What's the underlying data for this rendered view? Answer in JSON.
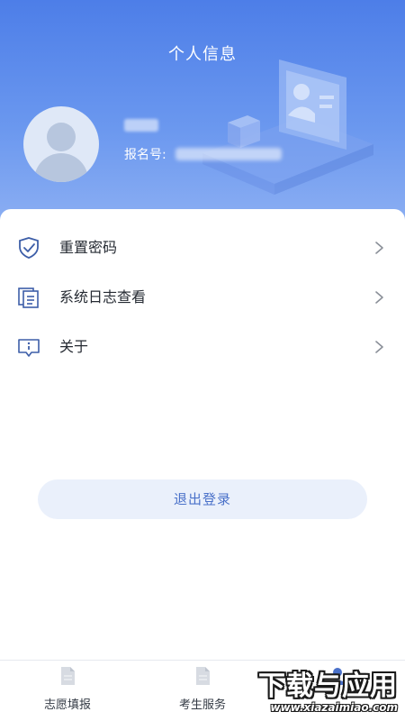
{
  "header": {
    "title": "个人信息",
    "registration_label": "报名号:",
    "avatar_icon": "user-avatar-icon"
  },
  "menu": [
    {
      "label": "重置密码",
      "icon": "shield-check-icon"
    },
    {
      "label": "系统日志查看",
      "icon": "document-list-icon"
    },
    {
      "label": "关于",
      "icon": "info-icon"
    }
  ],
  "logout_label": "退出登录",
  "tabbar": [
    {
      "label": "志愿填报",
      "icon": "document-icon"
    },
    {
      "label": "考生服务",
      "icon": "document-icon"
    },
    {
      "label": "",
      "icon": "user-icon"
    }
  ],
  "watermark": {
    "main": "下载与应用",
    "url": "www.xiazaimiao.com"
  },
  "colors": {
    "header_top": "#4d7ee8",
    "header_bottom": "#8fb1f3",
    "accent": "#4a71c9",
    "logout_bg": "#eaf0fb"
  }
}
